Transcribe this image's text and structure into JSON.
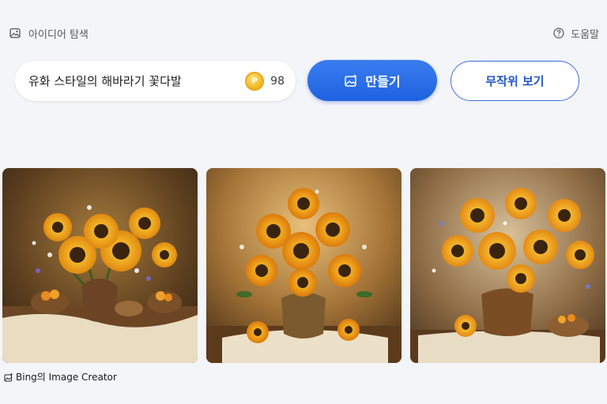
{
  "header": {
    "explore_label": "아이디어 탐색",
    "help_label": "도움말"
  },
  "prompt": {
    "text": "유화 스타일의 해바라기 꽃다발",
    "coins": "98"
  },
  "buttons": {
    "create_label": "만들기",
    "random_label": "무작위 보기"
  },
  "gallery": {
    "images": [
      {
        "name": "sunflower-bouquet-image-1"
      },
      {
        "name": "sunflower-bouquet-image-2"
      },
      {
        "name": "sunflower-bouquet-image-3"
      }
    ]
  },
  "footer": {
    "credit": "Bing의 Image Creator"
  },
  "colors": {
    "accent": "#1f62e0",
    "background": "#f4f5f9",
    "coin": "#f2b81f"
  },
  "icons": {
    "explore": "image-icon",
    "help": "question-circle-icon",
    "create": "image-sparkle-icon",
    "credit": "image-sparkle-icon"
  }
}
